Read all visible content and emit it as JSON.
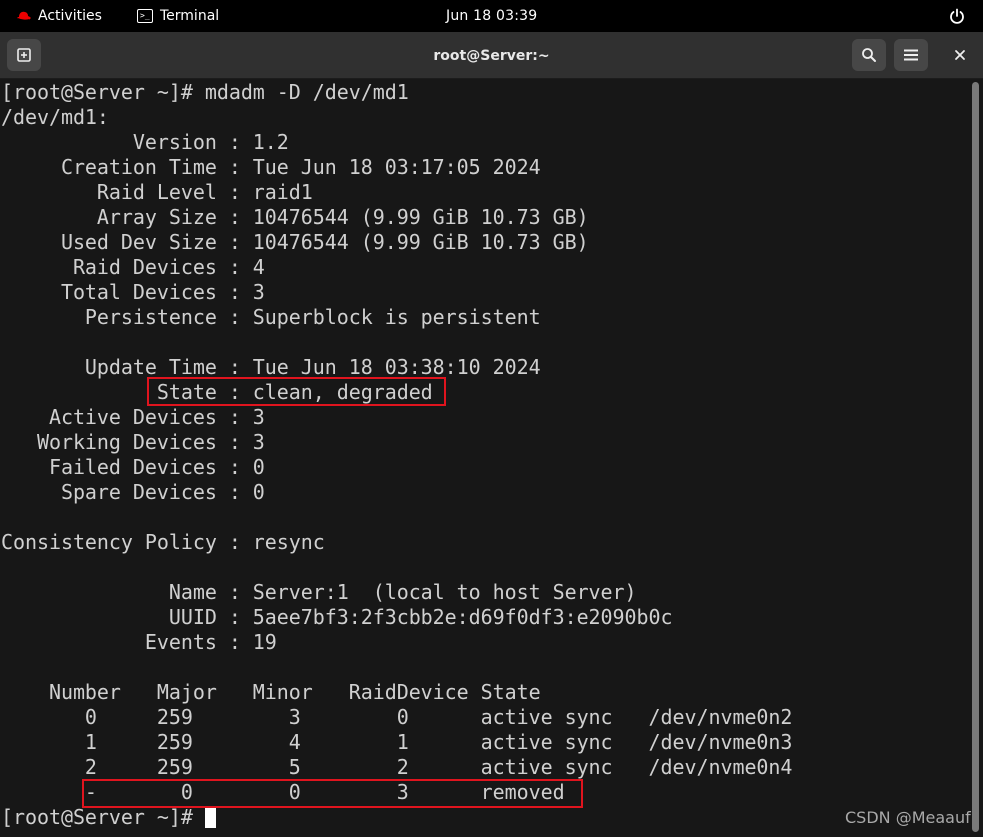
{
  "topbar": {
    "activities_label": "Activities",
    "app_label": "Terminal",
    "clock": "Jun 18  03:39",
    "icons": {
      "distro": "redhat-icon",
      "app": "terminal-icon",
      "power": "power-icon"
    }
  },
  "window": {
    "title": "root@Server:~",
    "buttons": {
      "new_tab": "new-tab-icon",
      "search": "search-icon",
      "menu": "hamburger-menu-icon",
      "close": "close-icon"
    }
  },
  "terminal": {
    "lines": [
      "[root@Server ~]# mdadm -D /dev/md1",
      "/dev/md1:",
      "           Version : 1.2",
      "     Creation Time : Tue Jun 18 03:17:05 2024",
      "        Raid Level : raid1",
      "        Array Size : 10476544 (9.99 GiB 10.73 GB)",
      "     Used Dev Size : 10476544 (9.99 GiB 10.73 GB)",
      "      Raid Devices : 4",
      "     Total Devices : 3",
      "       Persistence : Superblock is persistent",
      "",
      "       Update Time : Tue Jun 18 03:38:10 2024",
      "             State : clean, degraded",
      "    Active Devices : 3",
      "   Working Devices : 3",
      "    Failed Devices : 0",
      "     Spare Devices : 0",
      "",
      "Consistency Policy : resync",
      "",
      "              Name : Server:1  (local to host Server)",
      "              UUID : 5aee7bf3:2f3cbb2e:d69f0df3:e2090b0c",
      "            Events : 19",
      "",
      "    Number   Major   Minor   RaidDevice State",
      "       0     259        3        0      active sync   /dev/nvme0n2",
      "       1     259        4        1      active sync   /dev/nvme0n3",
      "       2     259        5        2      active sync   /dev/nvme0n4",
      "       -       0        0        3      removed"
    ],
    "prompt": "[root@Server ~]# "
  },
  "watermark": "CSDN @Meaauf",
  "colors": {
    "terminal_bg": "#171717",
    "terminal_fg": "#d0d0d0",
    "highlight_box": "#e0141e",
    "topbar_bg": "#000000",
    "headerbar_bg": "#303030"
  }
}
